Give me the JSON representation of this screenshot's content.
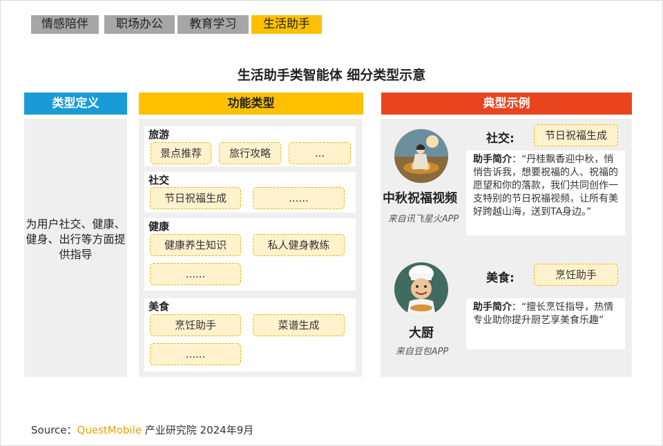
{
  "tabs": [
    {
      "label": "情感陪伴",
      "active": false
    },
    {
      "label": "职场办公",
      "active": false
    },
    {
      "label": "教育学习",
      "active": false
    },
    {
      "label": "生活助手",
      "active": true
    }
  ],
  "title": "生活助手类智能体 细分类型示意",
  "columns": {
    "definition": "类型定义",
    "function": "功能类型",
    "examples": "典型示例"
  },
  "definition_text": "为用户社交、健康、健身、出行等方面提供指导",
  "categories": [
    {
      "name": "旅游",
      "items": [
        "景点推荐",
        "旅行攻略",
        "..."
      ]
    },
    {
      "name": "社交",
      "items": [
        "节日祝福生成",
        "......"
      ]
    },
    {
      "name": "健康",
      "items": [
        "健康养生知识",
        "私人健身教练",
        "......"
      ]
    },
    {
      "name": "美食",
      "items": [
        "烹饪助手",
        "菜谱生成",
        "......"
      ]
    }
  ],
  "examples": [
    {
      "name": "中秋祝福视频",
      "source": "来自讯飞星火APP",
      "label": "社交:",
      "tag": "节日祝福生成",
      "intro_label": "助手简介",
      "intro_text": "：“丹桂飘香迎中秋，悄悄告诉我，想要祝福的人、祝福的愿望和你的落款，我们共同创作一支特别的节日祝福视频，让所有美好跨越山海，送到TA身边。”"
    },
    {
      "name": "大厨",
      "source": "来自豆包APP",
      "label": "美食:",
      "tag": "烹饪助手",
      "intro_label": "助手简介",
      "intro_text": "：“擅长烹饪指导，热情专业助你提升厨艺享美食乐趣”"
    }
  ],
  "source": {
    "prefix": "Source：",
    "brand": "QuestMobile",
    "suffix": " 产业研究院 2024年9月"
  },
  "colors": {
    "tab_gray": "#a6a6a6",
    "tab_active": "#ffc000",
    "definition_header": "#1a9bd7",
    "function_header": "#ffc000",
    "examples_header": "#e8451e",
    "pill_fill": "#fff2cc",
    "pill_border": "#f0b400",
    "brand": "#f0a000"
  }
}
